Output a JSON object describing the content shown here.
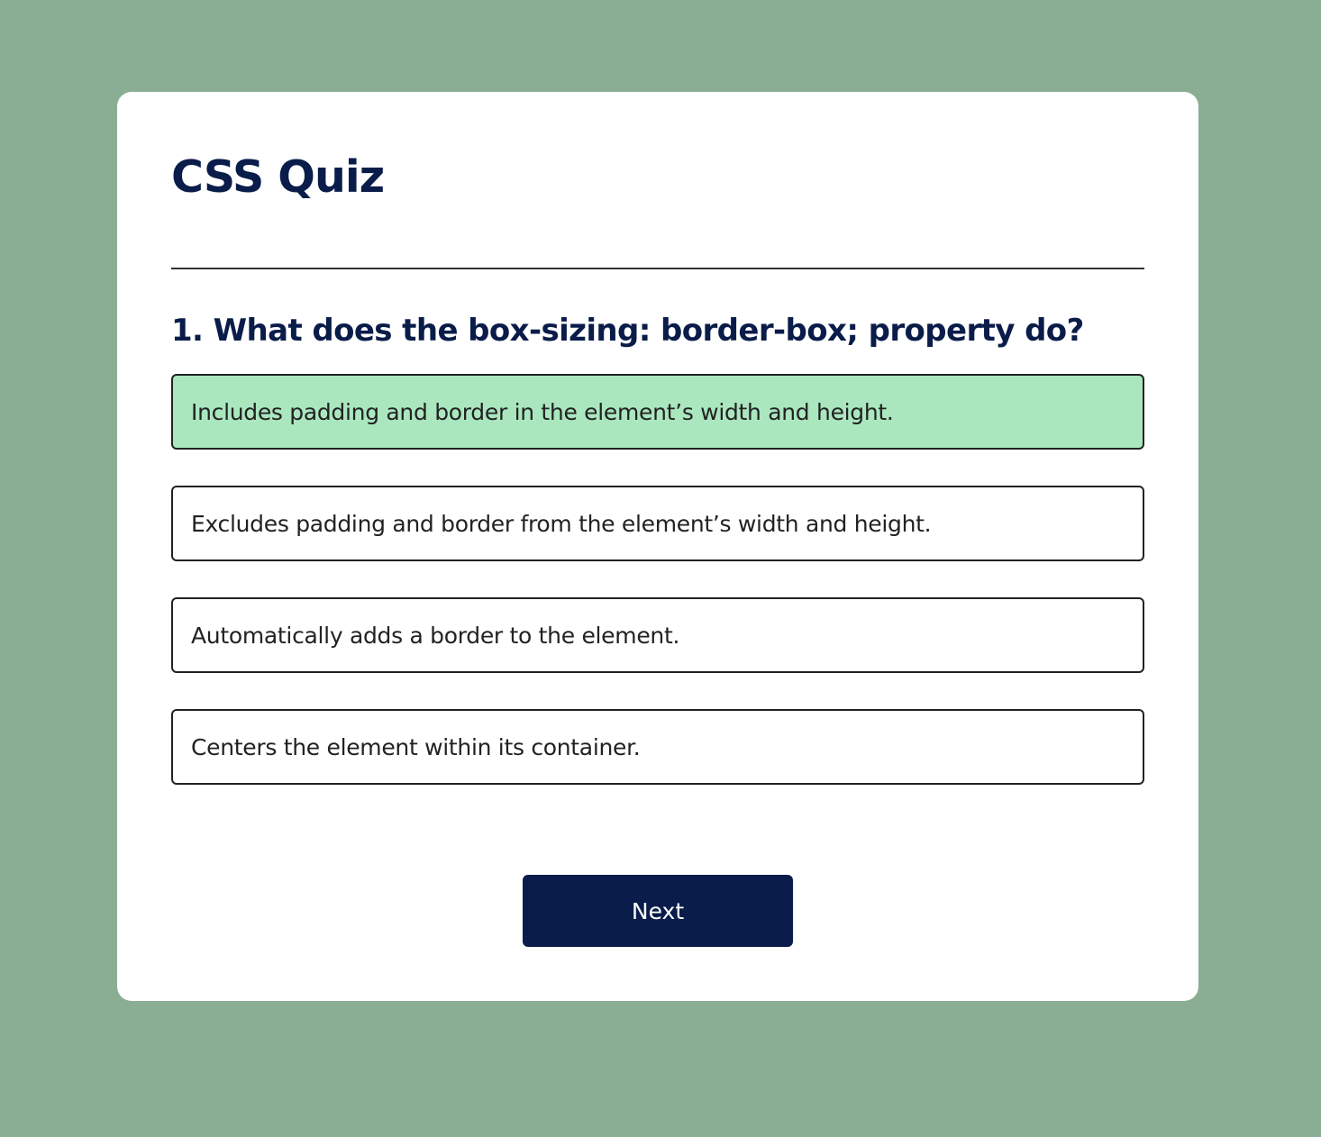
{
  "quiz": {
    "title": "CSS Quiz",
    "question": "1. What does the box-sizing: border-box; property do?",
    "options": [
      {
        "label": "Includes padding and border in the element’s width and height.",
        "selected": true
      },
      {
        "label": "Excludes padding and border from the element’s width and height.",
        "selected": false
      },
      {
        "label": "Automatically adds a border to the element.",
        "selected": false
      },
      {
        "label": "Centers the element within its container.",
        "selected": false
      }
    ],
    "next_label": "Next"
  },
  "colors": {
    "background": "#8aae93",
    "card": "#ffffff",
    "heading": "#0a1c49",
    "selected_option": "#aae7bf",
    "button": "#0a1c49"
  }
}
